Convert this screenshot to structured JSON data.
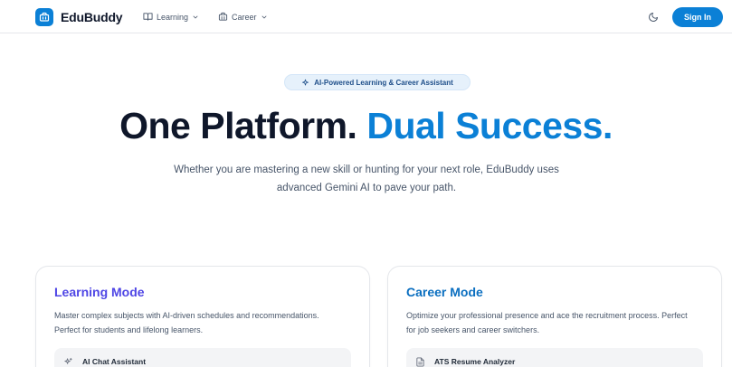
{
  "header": {
    "logo_text": "EduBuddy",
    "nav": [
      {
        "label": "Learning",
        "icon": "book-open-icon"
      },
      {
        "label": "Career",
        "icon": "briefcase-icon"
      }
    ],
    "theme_toggle_icon": "moon-icon",
    "signin_label": "Sign In",
    "accent_color": "#0b80d6"
  },
  "hero": {
    "badge": "AI-Powered Learning & Career Assistant",
    "title_part1": "One Platform.",
    "title_part2": "Dual Success.",
    "subtitle": "Whether you are mastering a new skill or hunting for your next role, EduBuddy uses advanced Gemini AI to pave your path."
  },
  "cards": [
    {
      "title": "Learning Mode",
      "description": "Master complex subjects with AI-driven schedules and recommendations. Perfect for students and lifelong learners.",
      "feature": "AI Chat Assistant",
      "title_color": "#4f46e5"
    },
    {
      "title": "Career Mode",
      "description": "Optimize your professional presence and ace the recruitment process. Perfect for job seekers and career switchers.",
      "feature": "ATS Resume Analyzer",
      "title_color": "#0b6fc0"
    }
  ]
}
